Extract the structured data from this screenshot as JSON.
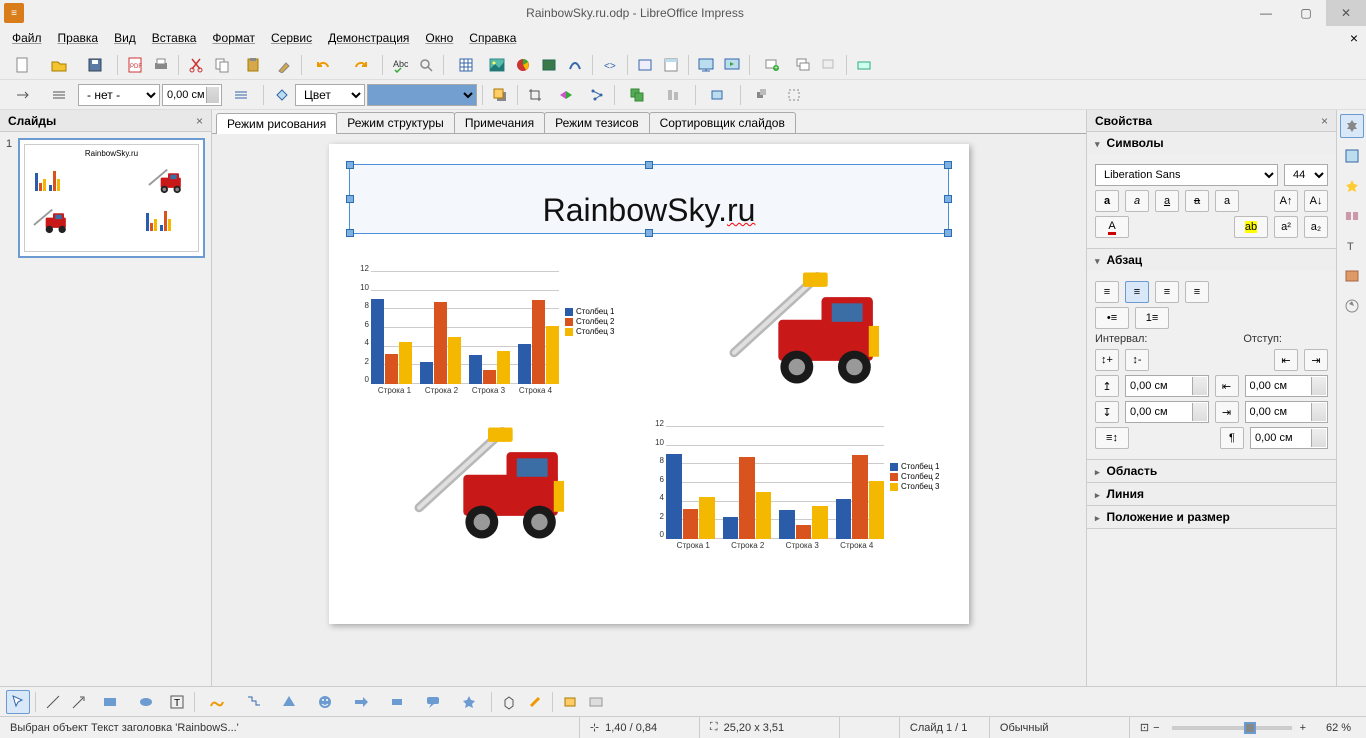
{
  "title_bar": {
    "title": "RainbowSky.ru.odp - LibreOffice Impress"
  },
  "menu": {
    "items": [
      "Файл",
      "Правка",
      "Вид",
      "Вставка",
      "Формат",
      "Сервис",
      "Демонстрация",
      "Окно",
      "Справка"
    ]
  },
  "toolbar2": {
    "line_style": "- нет -",
    "line_width": "0,00 см",
    "fill_label": "Цвет"
  },
  "slides_panel": {
    "title": "Слайды",
    "thumb_title": "RainbowSky.ru",
    "slide_num": "1"
  },
  "view_tabs": [
    "Режим рисования",
    "Режим структуры",
    "Примечания",
    "Режим тезисов",
    "Сортировщик слайдов"
  ],
  "slide": {
    "title_plain": "RainbowSky.",
    "title_wavy": "ru"
  },
  "chart_data": {
    "type": "bar",
    "categories": [
      "Строка 1",
      "Строка 2",
      "Строка 3",
      "Строка 4"
    ],
    "series": [
      {
        "name": "Столбец 1",
        "color": "#2a5caa",
        "values": [
          9.1,
          2.4,
          3.1,
          4.3
        ]
      },
      {
        "name": "Столбец 2",
        "color": "#d9531e",
        "values": [
          3.2,
          8.8,
          1.5,
          9.0
        ]
      },
      {
        "name": "Столбец 3",
        "color": "#f5b800",
        "values": [
          4.5,
          5.0,
          3.5,
          6.2
        ]
      }
    ],
    "ylim": [
      0,
      12
    ],
    "yticks": [
      0,
      2,
      4,
      6,
      8,
      10,
      12
    ]
  },
  "props": {
    "title": "Свойства",
    "symbols": {
      "title": "Символы",
      "font": "Liberation Sans",
      "size": "44"
    },
    "paragraph": {
      "title": "Абзац",
      "interval_label": "Интервал:",
      "indent_label": "Отступ:",
      "spin_val": "0,00 см"
    },
    "sections": {
      "area": "Область",
      "line": "Линия",
      "pos": "Положение и размер"
    }
  },
  "status": {
    "selection": "Выбран объект Текст заголовка 'RainbowS...'",
    "pos": "1,40 / 0,84",
    "size": "25,20 x 3,51",
    "slide": "Слайд 1 / 1",
    "page_style": "Обычный",
    "zoom": "62 %"
  }
}
